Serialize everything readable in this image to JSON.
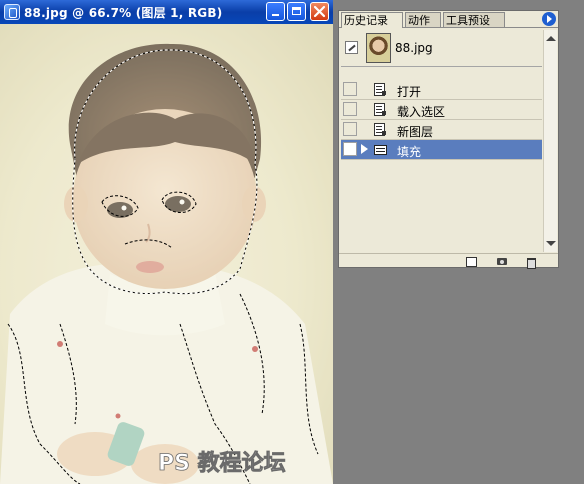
{
  "document_window": {
    "title": "88.jpg @ 66.7% (图层 1, RGB)",
    "photo_watermark": "PS 教程论坛"
  },
  "history_panel": {
    "tabs": [
      {
        "label": "历史记录",
        "active": true
      },
      {
        "label": "动作",
        "active": false
      },
      {
        "label": "工具预设",
        "active": false
      }
    ],
    "snapshot": {
      "label": "88.jpg"
    },
    "steps": [
      {
        "label": "打开",
        "icon": "document-icon",
        "selected": false
      },
      {
        "label": "载入选区",
        "icon": "document-icon",
        "selected": false
      },
      {
        "label": "新图层",
        "icon": "document-icon",
        "selected": false
      },
      {
        "label": "填充",
        "icon": "fill-icon",
        "selected": true
      }
    ]
  },
  "colors": {
    "titlebar": "#0a3ea8",
    "selection_highlight": "#5a7dbe",
    "workspace_bg": "#808080",
    "panel_bg": "#ece9d8"
  }
}
